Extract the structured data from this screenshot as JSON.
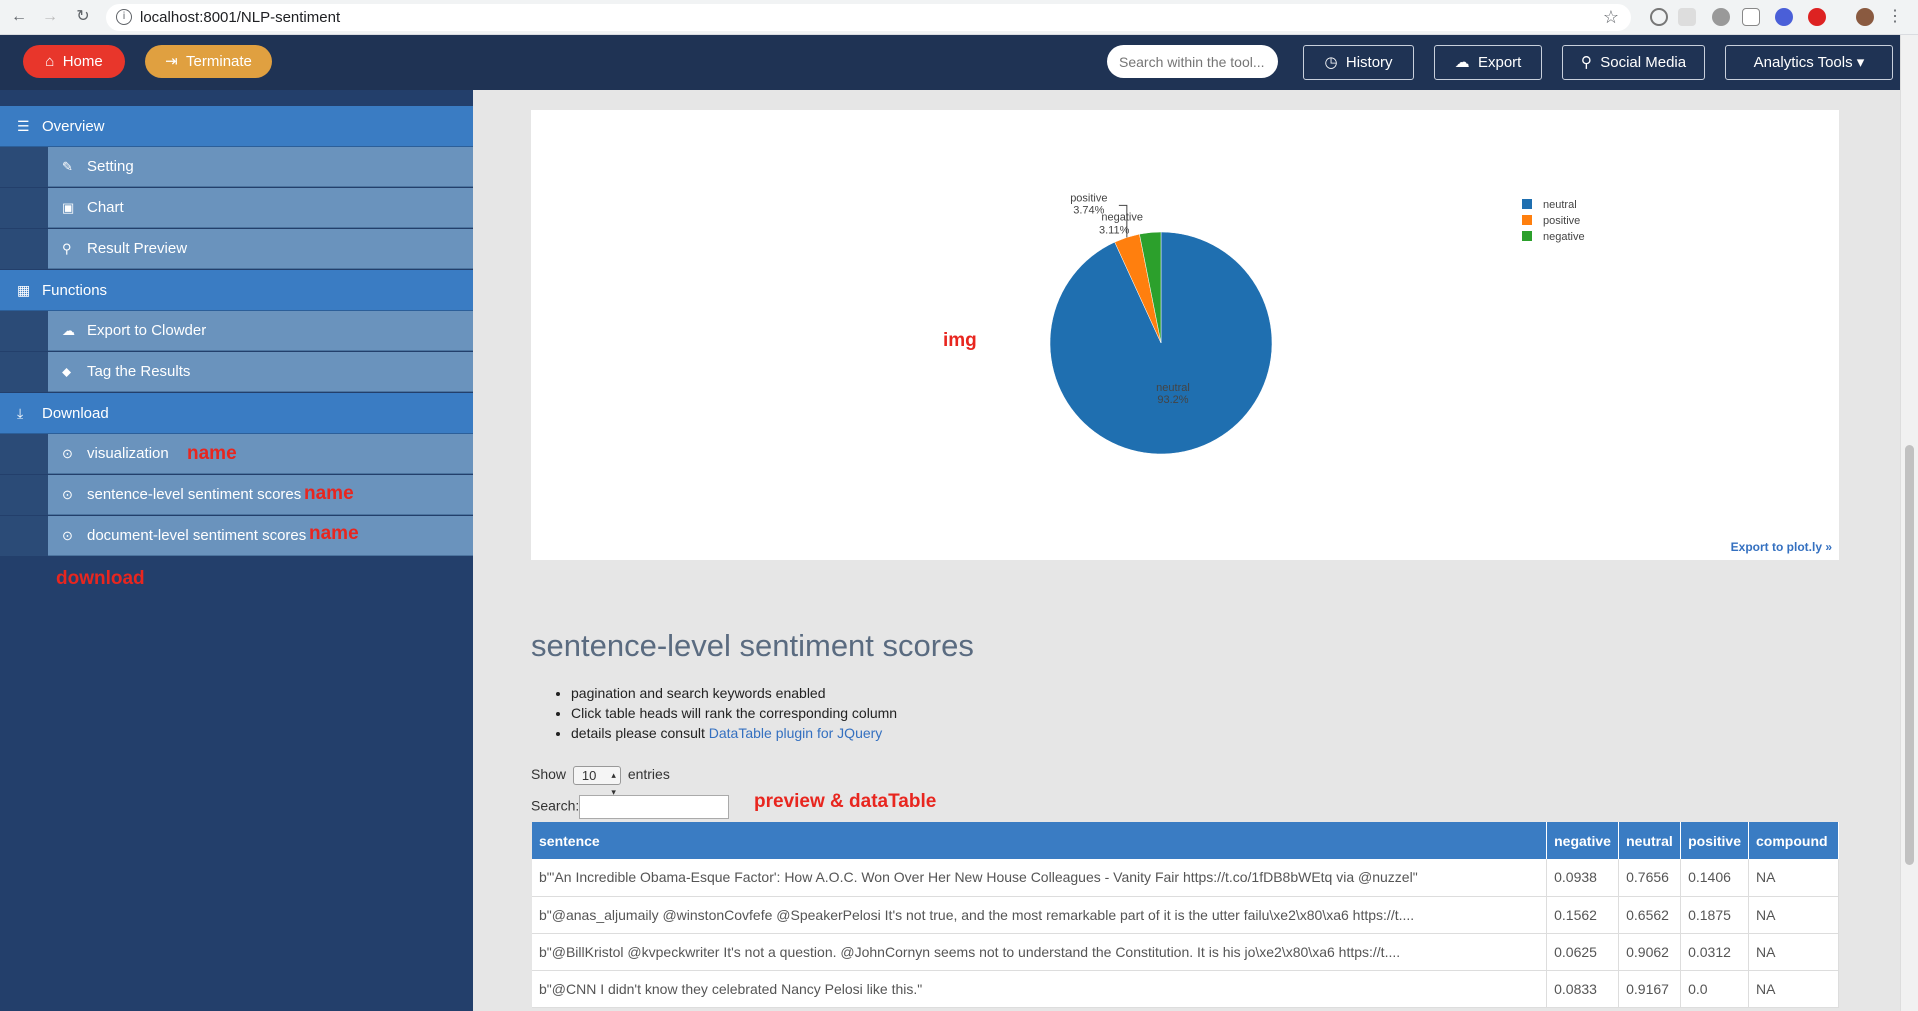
{
  "browser": {
    "url": "localhost:8001/NLP-sentiment"
  },
  "header": {
    "home_label": "Home",
    "terminate_label": "Terminate",
    "search_placeholder": "Search within the tool...",
    "history_label": "History",
    "export_label": "Export",
    "social_label": "Social Media",
    "analytics_label": "Analytics Tools"
  },
  "sidebar": {
    "overview": "Overview",
    "setting": "Setting",
    "chart": "Chart",
    "result_preview": "Result Preview",
    "functions": "Functions",
    "export_clowder": "Export to Clowder",
    "tag_results": "Tag the Results",
    "download": "Download",
    "visualization": "visualization",
    "sentence_scores": "sentence-level sentiment scores",
    "document_scores": "document-level sentiment scores"
  },
  "annotations": {
    "name1": "name",
    "name2": "name",
    "name3": "name",
    "download": "download",
    "img": "img",
    "preview": "preview & dataTable"
  },
  "chart_data": {
    "type": "pie",
    "labels": [
      "neutral",
      "positive",
      "negative"
    ],
    "values": [
      93.2,
      3.74,
      3.11
    ],
    "slice_labels": [
      "93.2%",
      "3.74%",
      "3.11%"
    ],
    "colors": [
      "#1f6fb0",
      "#ff7f0e",
      "#2ca02c"
    ],
    "legend_position": "right",
    "export_link": "Export to plot.ly »"
  },
  "section": {
    "title": "sentence-level sentiment scores",
    "bullet1": "pagination and search keywords enabled",
    "bullet2": "Click table heads will rank the corresponding column",
    "bullet3_prefix": "details please consult ",
    "bullet3_link": "DataTable plugin for JQuery"
  },
  "controls": {
    "show_label": "Show",
    "entries_value": "10",
    "entries_label": "entries",
    "search_label": "Search:"
  },
  "table": {
    "headers": [
      "sentence",
      "negative",
      "neutral",
      "positive",
      "compound"
    ],
    "rows": [
      [
        "b\"'An Incredible Obama-Esque Factor': How A.O.C. Won Over Her New House Colleagues - Vanity Fair https://t.co/1fDB8bWEtq via @nuzzel\"",
        "0.0938",
        "0.7656",
        "0.1406",
        "NA"
      ],
      [
        "b\"@anas_aljumaily @winstonCovfefe @SpeakerPelosi It's not true, and the most remarkable part of it is the utter failu\\xe2\\x80\\xa6 https://t....",
        "0.1562",
        "0.6562",
        "0.1875",
        "NA"
      ],
      [
        "b\"@BillKristol @kvpeckwriter It's not a question. @JohnCornyn seems not to understand the Constitution. It is his jo\\xe2\\x80\\xa6 https://t....",
        "0.0625",
        "0.9062",
        "0.0312",
        "NA"
      ],
      [
        "b\"@CNN I didn't know they celebrated Nancy Pelosi like this.\"",
        "0.0833",
        "0.9167",
        "0.0",
        "NA"
      ]
    ]
  }
}
